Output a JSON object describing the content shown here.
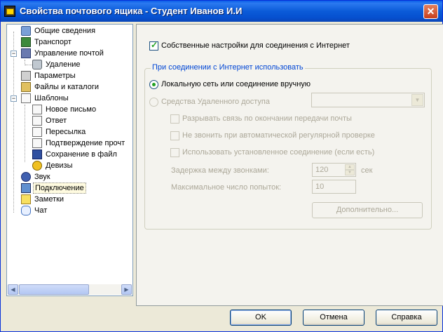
{
  "window": {
    "title": "Свойства почтового ящика - Студент Иванов И.И",
    "close_glyph": "✕"
  },
  "tree": {
    "items": [
      {
        "label": "Общие сведения",
        "icon": "user-card-icon"
      },
      {
        "label": "Транспорт",
        "icon": "truck-icon"
      },
      {
        "label": "Управление почтой",
        "icon": "mail-manage-icon"
      },
      {
        "label": "Удаление",
        "icon": "trash-icon"
      },
      {
        "label": "Параметры",
        "icon": "parameters-icon"
      },
      {
        "label": "Файлы и каталоги",
        "icon": "files-icon"
      },
      {
        "label": "Шаблоны",
        "icon": "templates-icon"
      },
      {
        "label": "Новое письмо",
        "icon": "document-icon"
      },
      {
        "label": "Ответ",
        "icon": "reply-icon"
      },
      {
        "label": "Пересылка",
        "icon": "forward-icon"
      },
      {
        "label": "Подтверждение прочт",
        "icon": "confirm-icon"
      },
      {
        "label": "Сохранение в файл",
        "icon": "save-icon"
      },
      {
        "label": "Девизы",
        "icon": "coins-icon"
      },
      {
        "label": "Звук",
        "icon": "sound-icon"
      },
      {
        "label": "Подключение",
        "icon": "monitor-icon"
      },
      {
        "label": "Заметки",
        "icon": "notes-icon"
      },
      {
        "label": "Чат",
        "icon": "chat-icon"
      }
    ],
    "selected": "Подключение",
    "expand_minus": "−"
  },
  "settings": {
    "own_settings_label": "Собственные настройки для соединения с Интернет",
    "group_label": "При соединении с Интернет использовать",
    "radio_lan": "Локальную сеть или соединение вручную",
    "radio_dialup": "Средства Удаленного доступа",
    "chk_disconnect": "Разрывать связь по окончании передачи почты",
    "chk_no_dial": "Не звонить при автоматической регулярной проверке",
    "chk_use_existing": "Использовать установленное соединение (если есть)",
    "delay_label": "Задержка между звонками:",
    "delay_value": "120",
    "delay_unit": "сек",
    "attempts_label": "Максимальное число попыток:",
    "attempts_value": "10",
    "advanced_button": "Дополнительно..."
  },
  "footer": {
    "ok": "OK",
    "cancel": "Отмена",
    "help": "Справка"
  }
}
